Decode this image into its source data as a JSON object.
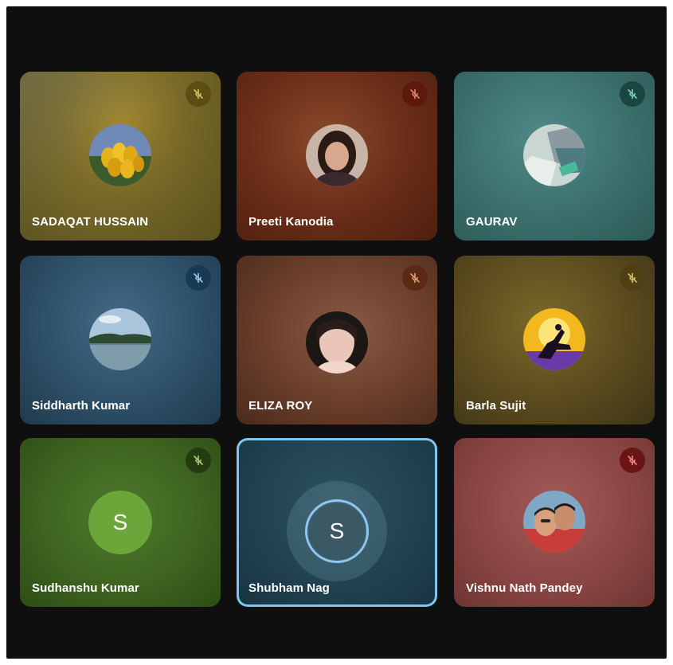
{
  "participants": [
    {
      "name": "SADAQAT HUSSAIN",
      "avatar": "tulips-photo",
      "mic": "mic-off-icon"
    },
    {
      "name": "Preeti Kanodia",
      "avatar": "profile-photo",
      "mic": "mic-off-icon"
    },
    {
      "name": "GAURAV",
      "avatar": "profile-photo",
      "mic": "mic-off-icon"
    },
    {
      "name": "Siddharth Kumar",
      "avatar": "lake-photo",
      "mic": "mic-off-icon"
    },
    {
      "name": "ELIZA ROY",
      "avatar": "profile-photo",
      "mic": "mic-off-icon"
    },
    {
      "name": "Barla Sujit",
      "avatar": "silhouette-sunset-photo",
      "mic": "mic-off-icon"
    },
    {
      "name": "Sudhanshu Kumar",
      "avatar_letter": "S",
      "mic": "mic-off-icon"
    },
    {
      "name": "Shubham Nag",
      "avatar_letter": "S",
      "speaking": true
    },
    {
      "name": "Vishnu Nath Pandey",
      "avatar": "profile-photo",
      "mic": "mic-off-icon"
    }
  ],
  "colors": {
    "background": "#0f0f10",
    "active_border": "#7cc6ef"
  }
}
